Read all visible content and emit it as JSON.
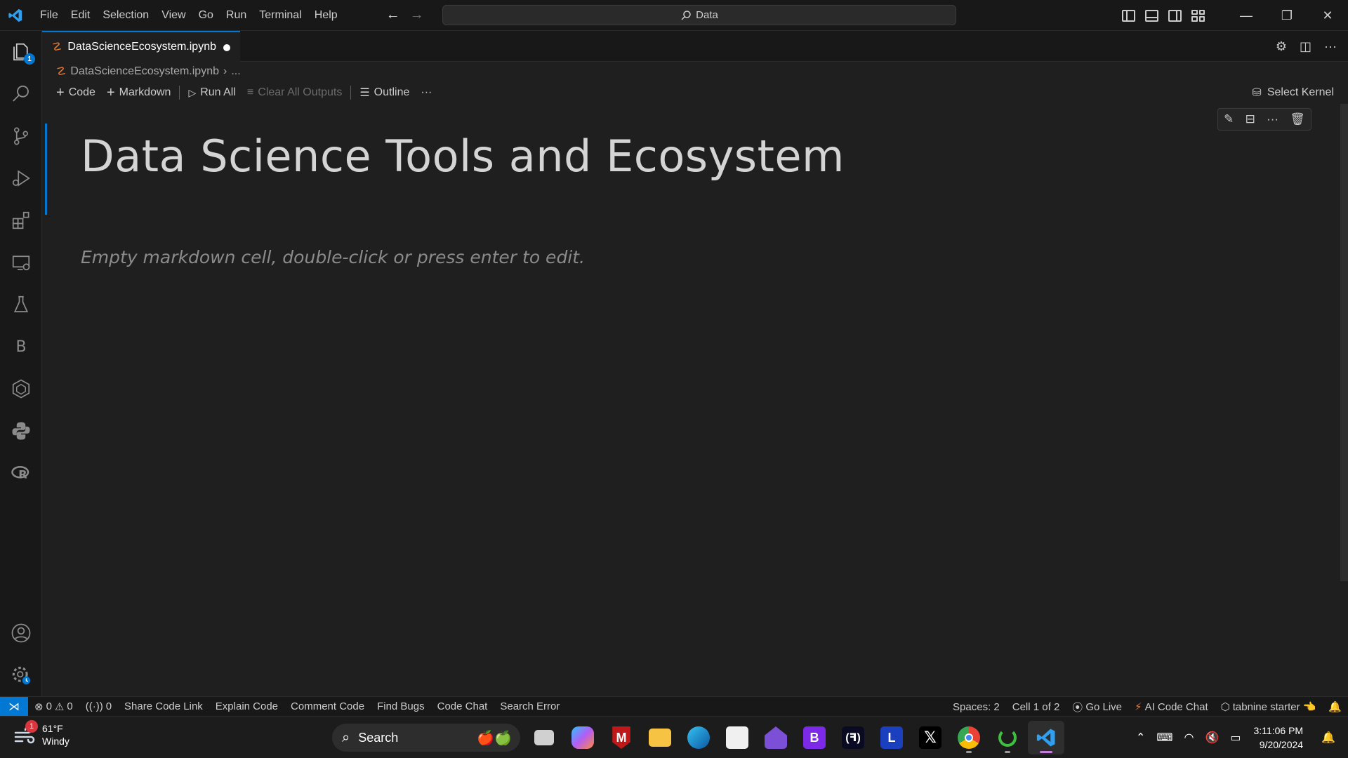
{
  "titlebar": {
    "menu": [
      "File",
      "Edit",
      "Selection",
      "View",
      "Go",
      "Run",
      "Terminal",
      "Help"
    ],
    "search": "Data"
  },
  "activitybar": {
    "explorer_badge": "1"
  },
  "tab": {
    "filename": "DataScienceEcosystem.ipynb",
    "icon": "jupyter-icon",
    "dirty": true
  },
  "breadcrumb": {
    "file": "DataScienceEcosystem.ipynb",
    "more": "..."
  },
  "notebook_toolbar": {
    "code": "Code",
    "markdown": "Markdown",
    "run_all": "Run All",
    "clear_outputs": "Clear All Outputs",
    "outline": "Outline",
    "more": "···",
    "select_kernel": "Select Kernel"
  },
  "cells": {
    "heading": "Data Science Tools and Ecosystem",
    "empty_placeholder": "Empty markdown cell, double-click or press enter to edit."
  },
  "statusbar": {
    "errors": "0",
    "warnings": "0",
    "ports": "0",
    "left_items": [
      "Share Code Link",
      "Explain Code",
      "Comment Code",
      "Find Bugs",
      "Code Chat",
      "Search Error"
    ],
    "spaces": "Spaces: 2",
    "cell": "Cell 1 of 2",
    "go_live": "Go Live",
    "ai_chat": "AI Code Chat",
    "tabnine": "tabnine starter"
  },
  "taskbar": {
    "weather_temp": "61°F",
    "weather_desc": "Windy",
    "weather_badge": "1",
    "search": "Search",
    "time": "3:11:06 PM",
    "date": "9/20/2024",
    "colors": {
      "accent": "#0078d4",
      "mcafee": "#c01818",
      "vscode_running": "#c27ddc"
    }
  }
}
